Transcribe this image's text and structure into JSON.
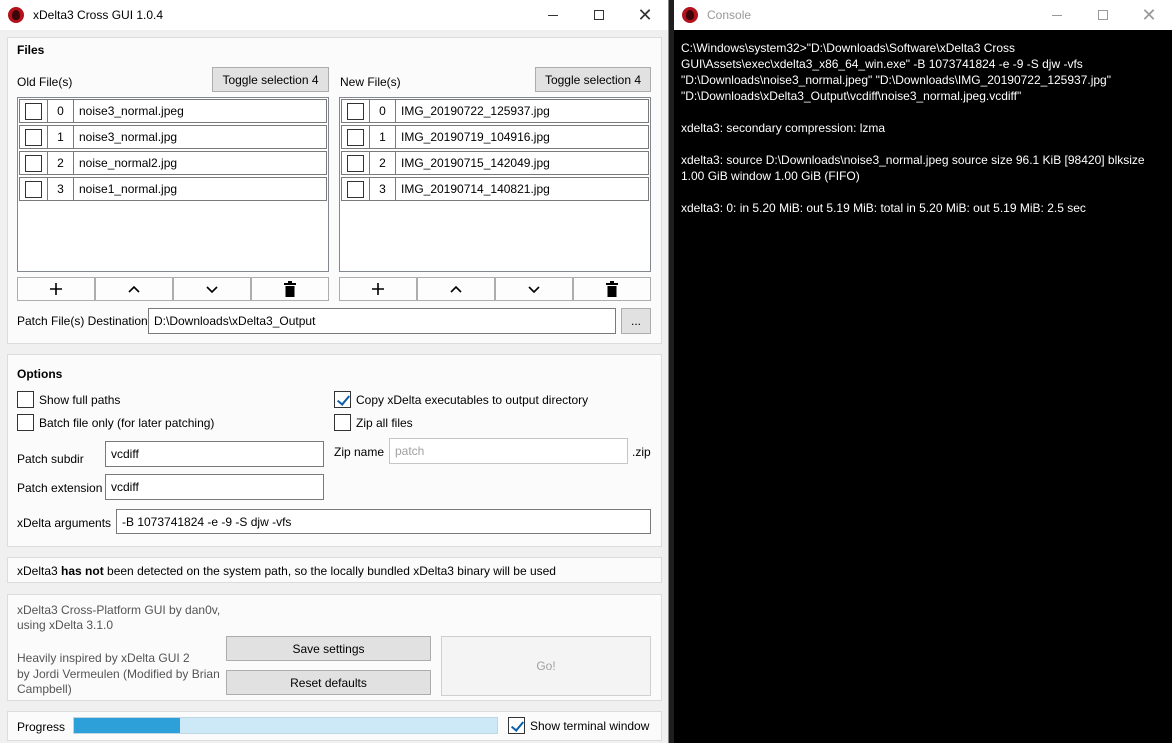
{
  "main_window": {
    "title": "xDelta3 Cross GUI 1.0.4"
  },
  "files": {
    "heading": "Files",
    "old": {
      "label": "Old File(s)",
      "toggle_label": "Toggle selection 4",
      "items": [
        {
          "index": "0",
          "name": "noise3_normal.jpeg",
          "checked": false
        },
        {
          "index": "1",
          "name": "noise3_normal.jpg",
          "checked": false
        },
        {
          "index": "2",
          "name": "noise_normal2.jpg",
          "checked": false
        },
        {
          "index": "3",
          "name": "noise1_normal.jpg",
          "checked": false
        }
      ]
    },
    "new": {
      "label": "New File(s)",
      "toggle_label": "Toggle selection 4",
      "items": [
        {
          "index": "0",
          "name": "IMG_20190722_125937.jpg",
          "checked": false
        },
        {
          "index": "1",
          "name": "IMG_20190719_104916.jpg",
          "checked": false
        },
        {
          "index": "2",
          "name": "IMG_20190715_142049.jpg",
          "checked": false
        },
        {
          "index": "3",
          "name": "IMG_20190714_140821.jpg",
          "checked": false
        }
      ]
    },
    "list_buttons": [
      "plus-icon",
      "chevron-up-icon",
      "chevron-down-icon",
      "trash-icon"
    ],
    "destination_label": "Patch File(s) Destination",
    "destination_value": "D:\\Downloads\\xDelta3_Output",
    "browse_label": "..."
  },
  "options": {
    "heading": "Options",
    "show_full_paths": {
      "label": "Show full paths",
      "checked": false
    },
    "copy_executables": {
      "label": "Copy xDelta executables to output directory",
      "checked": true
    },
    "batch_file_only": {
      "label": "Batch file only (for later patching)",
      "checked": false
    },
    "zip_all_files": {
      "label": "Zip all files",
      "checked": false
    },
    "patch_subdir_label": "Patch subdir",
    "patch_subdir_value": "vcdiff",
    "zip_name_label": "Zip name",
    "zip_name_placeholder": "patch",
    "zip_suffix": ".zip",
    "patch_extension_label": "Patch extension",
    "patch_extension_value": "vcdiff",
    "xdelta_args_label": "xDelta arguments",
    "xdelta_args_value": "-B 1073741824 -e -9 -S djw -vfs"
  },
  "notice": {
    "prefix": "xDelta3 ",
    "bold": "has not",
    "suffix": " been detected on the system path, so the locally bundled xDelta3 binary will be used"
  },
  "about": {
    "line1": "xDelta3 Cross-Platform GUI by dan0v,",
    "line2": "using xDelta 3.1.0",
    "line3": "Heavily inspired by xDelta GUI 2",
    "line4": "by Jordi Vermeulen (Modified by Brian",
    "line5": "Campbell)",
    "save_label": "Save settings",
    "reset_label": "Reset defaults",
    "go_label": "Go!"
  },
  "progress": {
    "label": "Progress",
    "value_fraction": 0.25,
    "show_terminal_label": "Show terminal window",
    "show_terminal_checked": true
  },
  "console_window": {
    "title": "Console",
    "lines": [
      "C:\\Windows\\system32>\"D:\\Downloads\\Software\\xDelta3 Cross GUI\\Assets\\exec\\xdelta3_x86_64_win.exe\" -B 1073741824 -e -9 -S djw -vfs \"D:\\Downloads\\noise3_normal.jpeg\" \"D:\\Downloads\\IMG_20190722_125937.jpg\" \"D:\\Downloads\\xDelta3_Output\\vcdiff\\noise3_normal.jpeg.vcdiff\"",
      "xdelta3: secondary compression: lzma",
      "xdelta3: source D:\\Downloads\\noise3_normal.jpeg source size 96.1 KiB [98420] blksize 1.00 GiB window 1.00 GiB (FIFO)",
      "xdelta3: 0: in 5.20 MiB: out 5.19 MiB: total in 5.20 MiB: out 5.19 MiB: 2.5 sec"
    ]
  }
}
